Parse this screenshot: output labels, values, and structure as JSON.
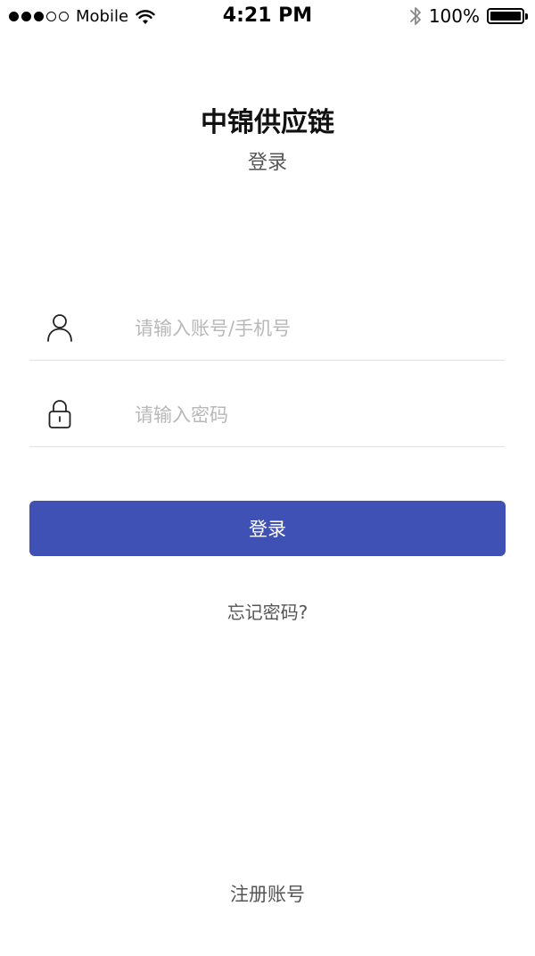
{
  "status_bar": {
    "carrier": "Mobile",
    "time": "4:21 PM",
    "battery": "100%",
    "signal_bars_filled": 3,
    "signal_bars_total": 5
  },
  "header": {
    "app_title": "中锦供应链",
    "subtitle": "登录"
  },
  "form": {
    "account": {
      "placeholder": "请输入账号/手机号",
      "value": "",
      "icon": "user-icon"
    },
    "password": {
      "placeholder": "请输入密码",
      "value": "",
      "icon": "lock-icon"
    },
    "login_label": "登录",
    "forgot_label": "忘记密码?"
  },
  "footer": {
    "register_label": "注册账号"
  },
  "colors": {
    "primary": "#3f51b5",
    "muted_text": "#555555",
    "placeholder": "#b8b8b8",
    "divider": "#e2e2e2"
  }
}
